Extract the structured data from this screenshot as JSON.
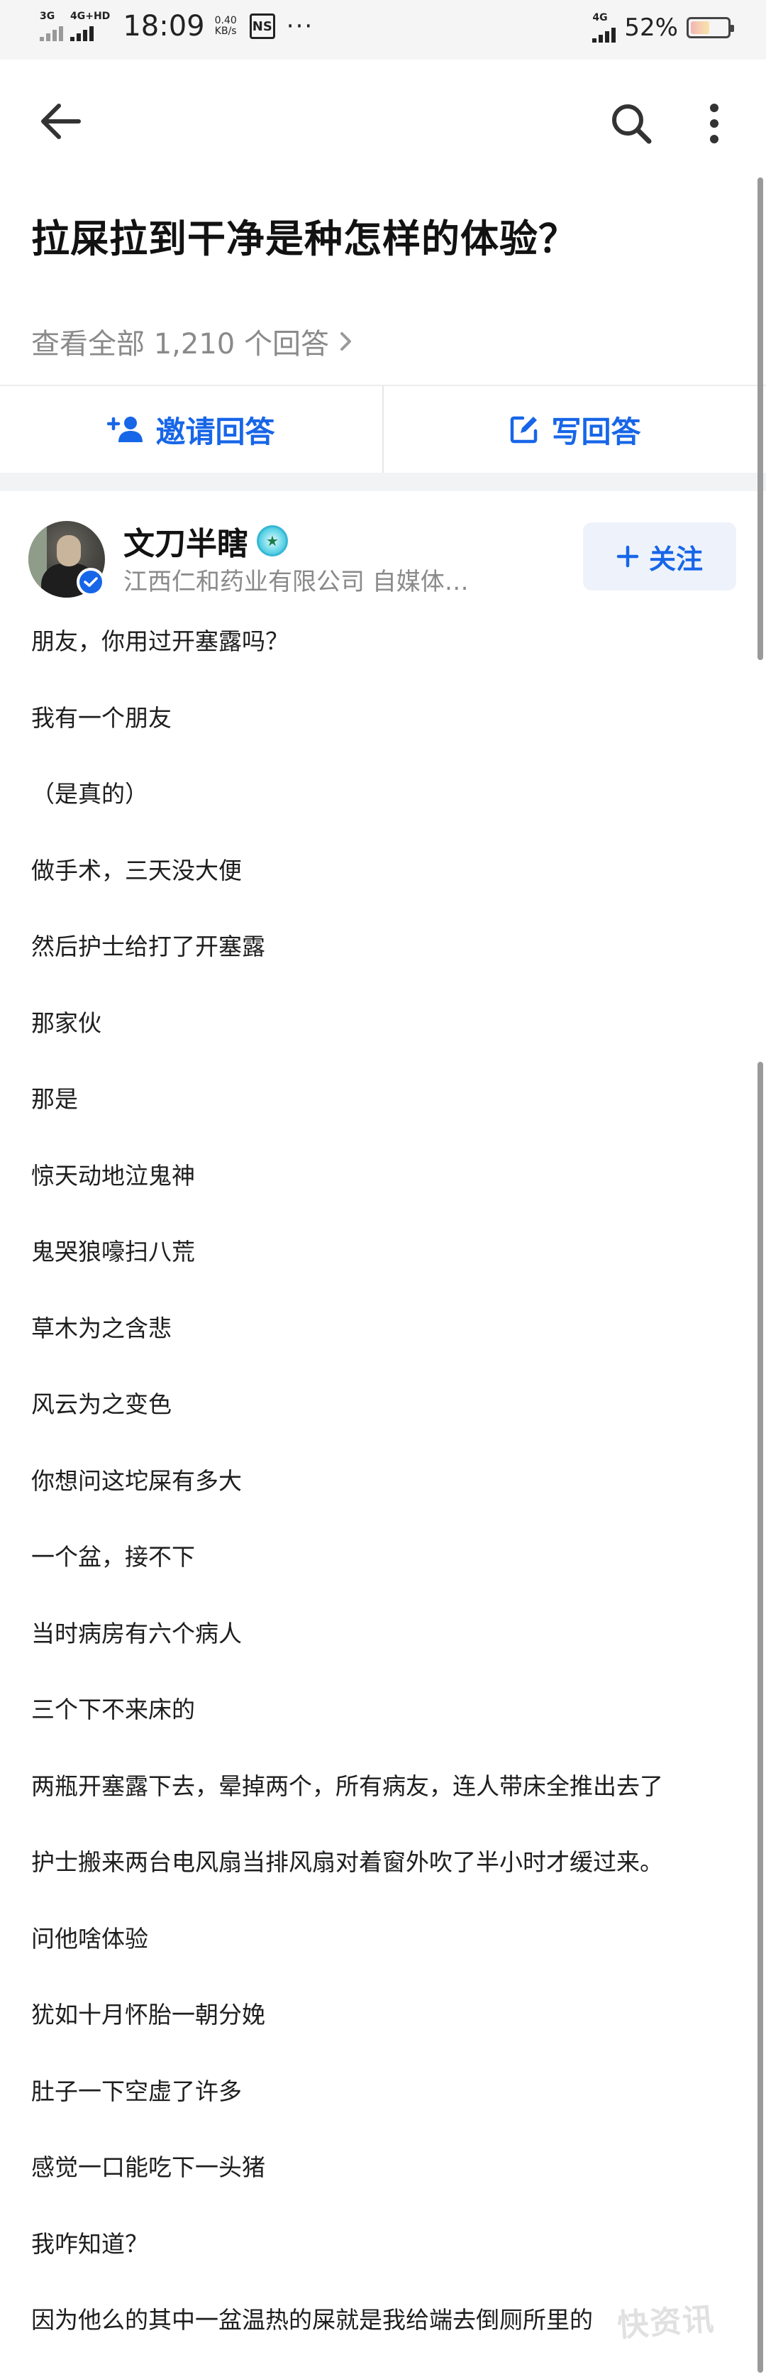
{
  "status_bar": {
    "network_left_1": "3G",
    "network_left_2": "4G+HD",
    "time": "18:09",
    "speed_value": "0.40",
    "speed_unit": "KB/s",
    "ns_icon": "NS",
    "more_dots": "···",
    "network_right": "4G",
    "battery_percent": "52%",
    "battery_level": 0.52
  },
  "nav": {
    "back_icon": "arrow-left-icon",
    "search_icon": "search-icon",
    "more_icon": "more-vertical-icon"
  },
  "question": {
    "title": "拉屎拉到干净是种怎样的体验？",
    "view_all": "查看全部 1,210 个回答"
  },
  "actions": {
    "invite_label": "邀请回答",
    "write_label": "写回答",
    "accent_color": "#1766e8"
  },
  "author": {
    "name": "文刀半瞎",
    "description": "江西仁和药业有限公司 自媒体…",
    "follow_label": "关注"
  },
  "answer": {
    "lines": [
      "朋友，你用过开塞露吗？",
      "我有一个朋友",
      "（是真的）",
      "做手术，三天没大便",
      "然后护士给打了开塞露",
      "那家伙",
      "那是",
      "惊天动地泣鬼神",
      "鬼哭狼嚎扫八荒",
      "草木为之含悲",
      "风云为之变色",
      "你想问这坨屎有多大",
      "一个盆，接不下",
      "当时病房有六个病人",
      "三个下不来床的",
      "两瓶开塞露下去，晕掉两个，所有病友，连人带床全推出去了",
      "护士搬来两台电风扇当排风扇对着窗外吹了半小时才缓过来。",
      "问他啥体验",
      "犹如十月怀胎一朝分娩",
      "肚子一下空虚了许多",
      "感觉一口能吃下一头猪",
      "我咋知道？",
      "因为他么的其中一盆温热的屎就是我给端去倒厕所里的"
    ]
  },
  "watermark": "快资讯"
}
